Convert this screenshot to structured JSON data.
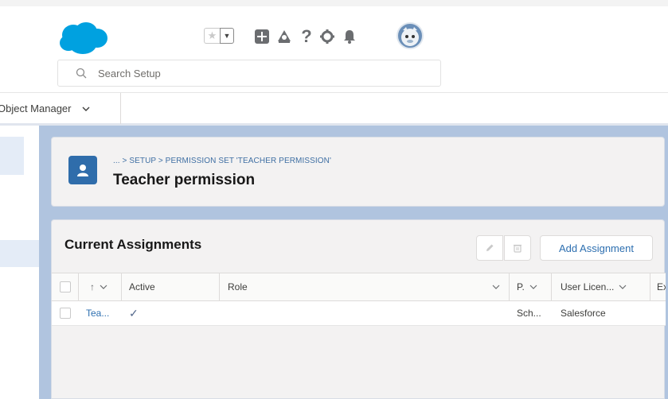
{
  "search": {
    "placeholder": "Search Setup"
  },
  "nav": {
    "object_manager": "Object Manager"
  },
  "header": {
    "breadcrumb": "... > SETUP > PERMISSION SET 'TEACHER PERMISSION'",
    "title": "Teacher permission"
  },
  "assignments": {
    "title": "Current Assignments",
    "add_label": "Add Assignment",
    "columns": {
      "sort": "↑",
      "active": "Active",
      "role": "Role",
      "profile": "P.",
      "license": "User Licen...",
      "extra": "Ex"
    },
    "rows": [
      {
        "name": "Tea...",
        "active": "✓",
        "role": "",
        "profile": "Sch...",
        "license": "Salesforce"
      }
    ]
  },
  "colors": {
    "brand": "#00a1e0",
    "link": "#2d6fb0",
    "canvas": "#b0c4df",
    "header_icon": "#2f6dab"
  }
}
